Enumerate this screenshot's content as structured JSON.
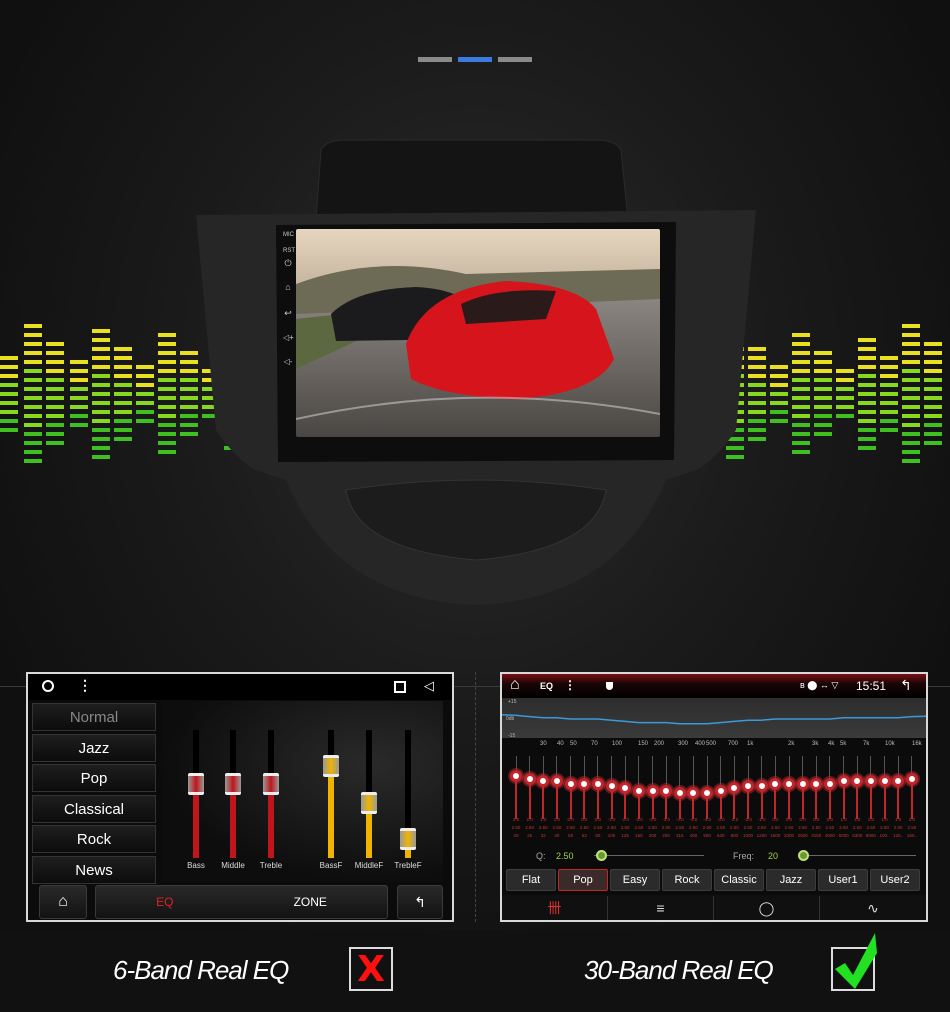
{
  "pager": {
    "count": 3,
    "active": 1,
    "active_color": "#3a7be0",
    "inactive_color": "#8a8a8a"
  },
  "head_unit": {
    "side_labels": [
      "MIC",
      "RST"
    ],
    "side_icons": [
      "power-icon",
      "home-icon",
      "back-icon",
      "volume-up-icon",
      "volume-down-icon"
    ]
  },
  "eq6": {
    "status_icons": [
      "circle-home-icon",
      "menu-dots-icon",
      "square-recent-icon",
      "triangle-back-icon"
    ],
    "presets": [
      "Normal",
      "Jazz",
      "Pop",
      "Classical",
      "Rock",
      "News"
    ],
    "selected_preset": "Normal",
    "sliders": [
      {
        "label": "Bass",
        "level": 0.58,
        "color": "#c0161b"
      },
      {
        "label": "Middle",
        "level": 0.58,
        "color": "#c0161b"
      },
      {
        "label": "Treble",
        "level": 0.58,
        "color": "#c0161b"
      },
      {
        "label": "BassF",
        "level": 0.72,
        "color": "#f0b400"
      },
      {
        "label": "MiddleF",
        "level": 0.43,
        "color": "#f0b400"
      },
      {
        "label": "TrebleF",
        "level": 0.15,
        "color": "#f0b400"
      }
    ],
    "tabs": {
      "eq": "EQ",
      "zone": "ZONE",
      "active": "EQ",
      "active_color": "#e02020"
    }
  },
  "eq30": {
    "status": {
      "title": "EQ",
      "time": "15:51"
    },
    "graph": {
      "y_labels": [
        "+15",
        "0db",
        "-15"
      ],
      "x_labels": [
        "30",
        "40",
        "50",
        "70",
        "100",
        "150",
        "200",
        "300",
        "400",
        "500",
        "700",
        "1k",
        "2k",
        "3k",
        "4k",
        "5k",
        "7k",
        "10k",
        "16k"
      ],
      "line_color": "#3a9ad9"
    },
    "bands": {
      "values": [
        "3.0",
        "2.0",
        "1.0",
        "1.0",
        "0.0",
        "0.0",
        "0.0",
        "-1.0",
        "-2.0",
        "-3.0",
        "-3.0",
        "-3.0",
        "-4.0",
        "-4.0",
        "-4.0",
        "-3.0",
        "-2.0",
        "-1.0",
        "-1.0",
        "0.0",
        "0.0",
        "0.0",
        "0.0",
        "0.0",
        "1.0",
        "1.0",
        "1.0",
        "1.0",
        "1.0",
        "2.0"
      ],
      "q": [
        "2.50",
        "2.50",
        "2.50",
        "2.50",
        "2.50",
        "2.50",
        "2.50",
        "2.50",
        "2.50",
        "2.50",
        "2.50",
        "2.50",
        "2.50",
        "2.50",
        "2.50",
        "2.50",
        "2.50",
        "2.50",
        "2.50",
        "2.50",
        "2.50",
        "2.50",
        "2.50",
        "2.50",
        "2.50",
        "2.50",
        "2.50",
        "2.50",
        "2.50",
        "2.50"
      ],
      "freqs": [
        "20",
        "25",
        "32",
        "40",
        "50",
        "63",
        "80",
        "100",
        "125",
        "160",
        "200",
        "250",
        "315",
        "400",
        "500",
        "630",
        "800",
        "1000",
        "1250",
        "1600",
        "2000",
        "2500",
        "3150",
        "4000",
        "5000",
        "6300",
        "8000",
        "100..",
        "125..",
        "160.."
      ]
    },
    "q_label": "Q:",
    "q_value": "2.50",
    "freq_label": "Freq:",
    "freq_value": "20",
    "presets": [
      "Flat",
      "Pop",
      "Easy",
      "Rock",
      "Classic",
      "Jazz",
      "User1",
      "User2"
    ],
    "selected_preset": "Pop",
    "nav_icons": [
      "eq-sliders-icon",
      "bars-icon",
      "circle-target-icon",
      "waveform-icon"
    ]
  },
  "captions": {
    "left": "6-Band Real EQ",
    "right": "30-Band Real EQ",
    "left_mark": "X",
    "left_mark_color": "#ff1010",
    "right_mark_color": "#22e022"
  }
}
